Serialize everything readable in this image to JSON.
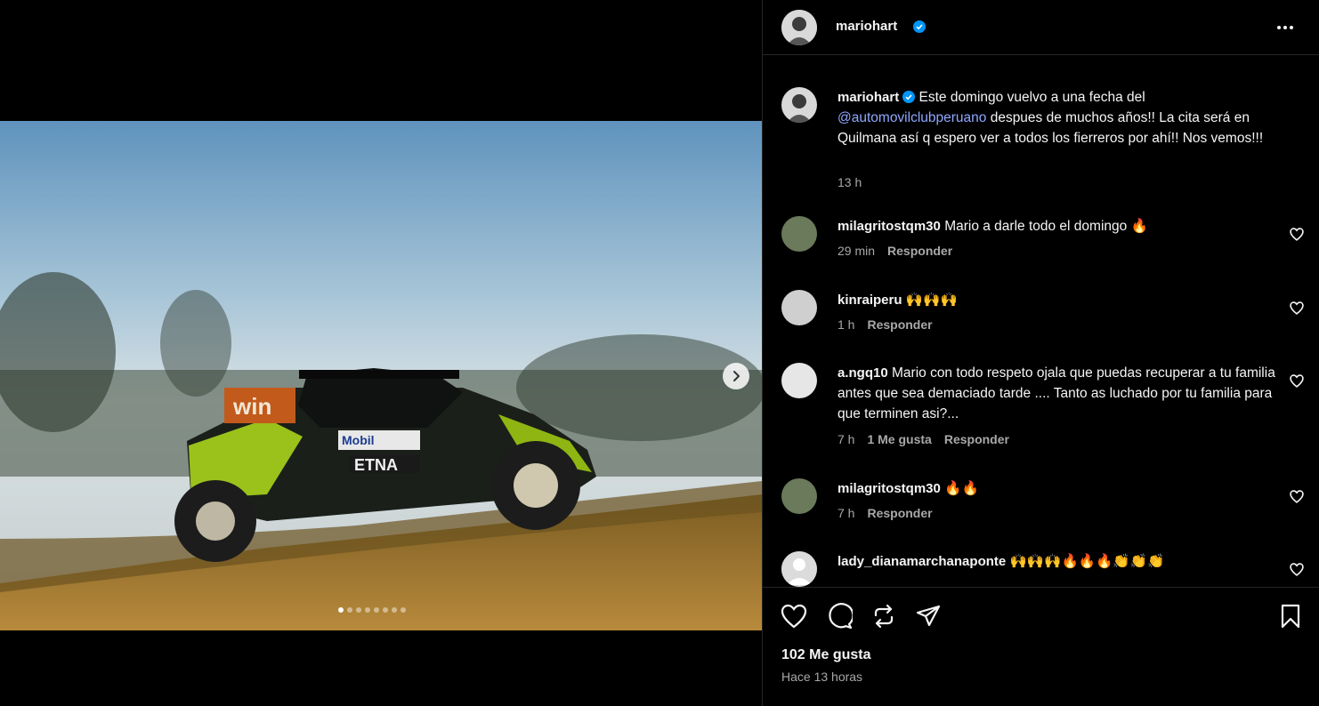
{
  "post": {
    "author": "mariohart",
    "media": {
      "slide_count": 8,
      "active_slide": 1,
      "overlay_text": {
        "sponsor_win": "win",
        "brand_mobil": "Mobil",
        "brand_etna": "ETNA"
      }
    },
    "caption": {
      "username": "mariohart",
      "text_before": "Este domingo vuelvo a una fecha del ",
      "mention": "@automovilclubperuano",
      "text_after": " despues de muchos años!! La cita será en Quilmana así q espero ver a todos los fierreros por ahí!! Nos vemos!!!",
      "time": "13 h"
    },
    "comments": [
      {
        "username": "milagritostqm30",
        "text": "Mario a darle todo el domingo 🔥",
        "time": "29 min",
        "likes_label": "",
        "reply": "Responder"
      },
      {
        "username": "kinraiperu",
        "text": "🙌🙌🙌",
        "time": "1 h",
        "likes_label": "",
        "reply": "Responder"
      },
      {
        "username": "a.ngq10",
        "text": "Mario con todo respeto ojala que puedas recuperar a tu familia antes que sea demaciado tarde .... Tanto as luchado por tu familia para que terminen asi?...",
        "time": "7 h",
        "likes_label": "1 Me gusta",
        "reply": "Responder"
      },
      {
        "username": "milagritostqm30",
        "text": "🔥🔥",
        "time": "7 h",
        "likes_label": "",
        "reply": "Responder"
      },
      {
        "username": "lady_dianamarchanaponte",
        "text": "🙌🙌🙌🔥🔥🔥👏👏👏",
        "time": "",
        "likes_label": "",
        "reply": ""
      }
    ],
    "likes": "102 Me gusta",
    "posted": "Hace 13 horas"
  },
  "icons": {
    "verified": "verified-badge-icon",
    "more": "more-options-icon",
    "like": "heart-icon",
    "comment": "comment-icon",
    "repost": "repost-icon",
    "share": "share-icon",
    "save": "bookmark-icon"
  },
  "colors": {
    "background": "#000000",
    "text": "#f5f5f5",
    "muted": "#a8a8a8",
    "mention": "#8fa8ff",
    "verified": "#0095f6"
  }
}
